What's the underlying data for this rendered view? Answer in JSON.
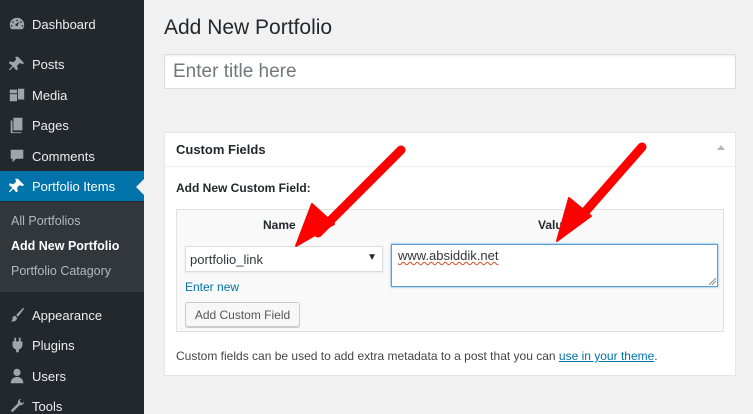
{
  "sidebar": {
    "items": [
      {
        "label": "Dashboard",
        "icon": "dashboard-icon"
      },
      {
        "label": "Posts",
        "icon": "pin-icon"
      },
      {
        "label": "Media",
        "icon": "media-icon"
      },
      {
        "label": "Pages",
        "icon": "pages-icon"
      },
      {
        "label": "Comments",
        "icon": "comments-icon"
      },
      {
        "label": "Portfolio Items",
        "icon": "pin-icon",
        "current": true
      },
      {
        "label": "Appearance",
        "icon": "paintbrush-icon"
      },
      {
        "label": "Plugins",
        "icon": "plugin-icon"
      },
      {
        "label": "Users",
        "icon": "users-icon"
      },
      {
        "label": "Tools",
        "icon": "tools-icon"
      }
    ],
    "submenu": [
      {
        "label": "All Portfolios"
      },
      {
        "label": "Add New Portfolio",
        "current": true
      },
      {
        "label": "Portfolio Catagory"
      }
    ]
  },
  "main": {
    "title": "Add New Portfolio",
    "title_placeholder": "Enter title here",
    "custom_fields": {
      "box_title": "Custom Fields",
      "new_field_label": "Add New Custom Field:",
      "col_name": "Name",
      "col_value": "Value",
      "selected_key": "portfolio_link",
      "value": "www.absiddik.net",
      "enter_new": "Enter new",
      "add_button": "Add Custom Field",
      "help_before": "Custom fields can be used to add extra metadata to a post that you can ",
      "help_link": "use in your theme",
      "help_after": "."
    }
  },
  "colors": {
    "sidebar_bg": "#23282d",
    "current_bg": "#0073aa",
    "link": "#0073aa",
    "annotation_arrow": "#ff0000"
  }
}
